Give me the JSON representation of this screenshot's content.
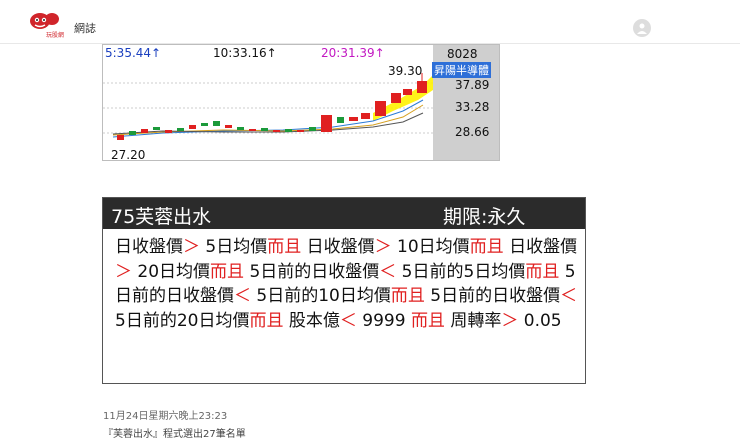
{
  "header": {
    "brand": "玩股網",
    "title": "網誌",
    "brand_color": "#d0252b"
  },
  "chart": {
    "time_labels": [
      "5:35.44",
      "10:33.16",
      "20:31.39"
    ],
    "arrow": "↑",
    "time_colors": [
      "#1a3fbf",
      "#111111",
      "#c218c2"
    ],
    "top_value": "8028",
    "high_label": "39.30",
    "stock_badge": "昇陽半導體",
    "prices": [
      "37.89",
      "33.28",
      "28.66"
    ],
    "low_label": "27.20"
  },
  "card": {
    "title": "75芙蓉出水",
    "period": "期限:永久",
    "condition_segments": [
      {
        "text": "日收盤價",
        "red": false
      },
      {
        "text": "＞",
        "red": true
      },
      {
        "text": " 5日均價",
        "red": false
      },
      {
        "text": "而且",
        "red": true
      },
      {
        "text": " 日收盤價",
        "red": false
      },
      {
        "text": "＞",
        "red": true
      },
      {
        "text": " 10日均價",
        "red": false
      },
      {
        "text": "而且",
        "red": true
      },
      {
        "text": " 日收盤價",
        "red": false
      },
      {
        "text": "＞",
        "red": true
      },
      {
        "text": " 20日均價",
        "red": false
      },
      {
        "text": "而且",
        "red": true
      },
      {
        "text": " 5日前的日收盤價",
        "red": false
      },
      {
        "text": "＜",
        "red": true
      },
      {
        "text": " 5日前的5日均價",
        "red": false
      },
      {
        "text": "而且",
        "red": true
      },
      {
        "text": " 5日前的日收盤價",
        "red": false
      },
      {
        "text": "＜",
        "red": true
      },
      {
        "text": " 5日前的10日均價",
        "red": false
      },
      {
        "text": "而且",
        "red": true
      },
      {
        "text": " 5日前的日收盤價",
        "red": false
      },
      {
        "text": "＜",
        "red": true
      },
      {
        "text": " 5日前的20日均價",
        "red": false
      },
      {
        "text": "而且",
        "red": true
      },
      {
        "text": " 股本億",
        "red": false
      },
      {
        "text": "＜",
        "red": true
      },
      {
        "text": " 9999 ",
        "red": false
      },
      {
        "text": "而且",
        "red": true
      },
      {
        "text": " 周轉率",
        "red": false
      },
      {
        "text": "＞",
        "red": true
      },
      {
        "text": " 0.05",
        "red": false
      }
    ]
  },
  "post": {
    "date": "11月24日星期六晚上23:23",
    "caption": "『芙蓉出水』程式選出27筆名單"
  },
  "icons": [
    "logo-icon",
    "avatar-icon",
    "up-arrow-icon"
  ]
}
